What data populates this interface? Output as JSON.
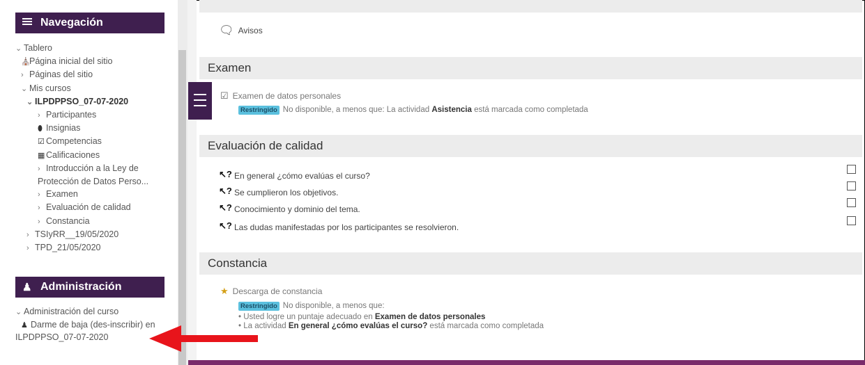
{
  "sidebar": {
    "nav_title": "Navegación",
    "items": [
      {
        "label": "Tablero",
        "marker": "⌄"
      },
      {
        "label": "Página inicial del sitio",
        "marker": "🏠"
      },
      {
        "label": "Páginas del sitio",
        "marker": "›"
      },
      {
        "label": "Mis cursos",
        "marker": "⌄"
      },
      {
        "label": "ILPDPPSO_07-07-2020",
        "marker": "⌄"
      },
      {
        "label": "Participantes",
        "marker": "›"
      },
      {
        "label": "Insignias",
        "marker": "⬮"
      },
      {
        "label": "Competencias",
        "marker": "☑"
      },
      {
        "label": "Calificaciones",
        "marker": "▦"
      },
      {
        "label": "Introducción a la Ley de Protección de Datos Perso...",
        "marker": "›"
      },
      {
        "label": "Examen",
        "marker": "›"
      },
      {
        "label": "Evaluación de calidad",
        "marker": "›"
      },
      {
        "label": "Constancia",
        "marker": "›"
      },
      {
        "label": "TSIyRR__19/05/2020",
        "marker": "›"
      },
      {
        "label": "TPD_21/05/2020",
        "marker": "›"
      }
    ],
    "admin_title": "Administración",
    "admin_items": [
      {
        "label": "Administración del curso",
        "marker": "⌄"
      },
      {
        "label": "Darme de baja (des-inscribir) en ILPDPPSO_07-07-2020",
        "marker": "👤"
      }
    ]
  },
  "main": {
    "avisos": "Avisos",
    "sections": {
      "examen": {
        "title": "Examen",
        "activity": "Examen de datos personales",
        "restricted_badge": "Restringido",
        "avail_prefix": "No disponible, a menos que: La actividad",
        "avail_bold": "Asistencia",
        "avail_suffix": "está marcada como completada"
      },
      "evaluacion": {
        "title": "Evaluación de calidad",
        "questions": [
          "En general ¿cómo evalúas el curso?",
          "Se cumplieron los objetivos.",
          "Conocimiento y dominio del tema.",
          "Las dudas manifestadas por los participantes se resolvieron."
        ]
      },
      "constancia": {
        "title": "Constancia",
        "activity": "Descarga de constancia",
        "restricted_badge": "Restringido",
        "avail_intro": "No disponible, a menos que:",
        "bullet1_prefix": "Usted logre un puntaje adecuado en",
        "bullet1_bold": "Examen de datos personales",
        "bullet2_prefix": "La actividad",
        "bullet2_bold": "En general ¿cómo evalúas el curso?",
        "bullet2_suffix": "está marcada como completada"
      }
    }
  },
  "colors": {
    "brand_purple": "#3f1f4f",
    "restricted_badge": "#5bc0de",
    "arrow_red": "#e8141b"
  }
}
